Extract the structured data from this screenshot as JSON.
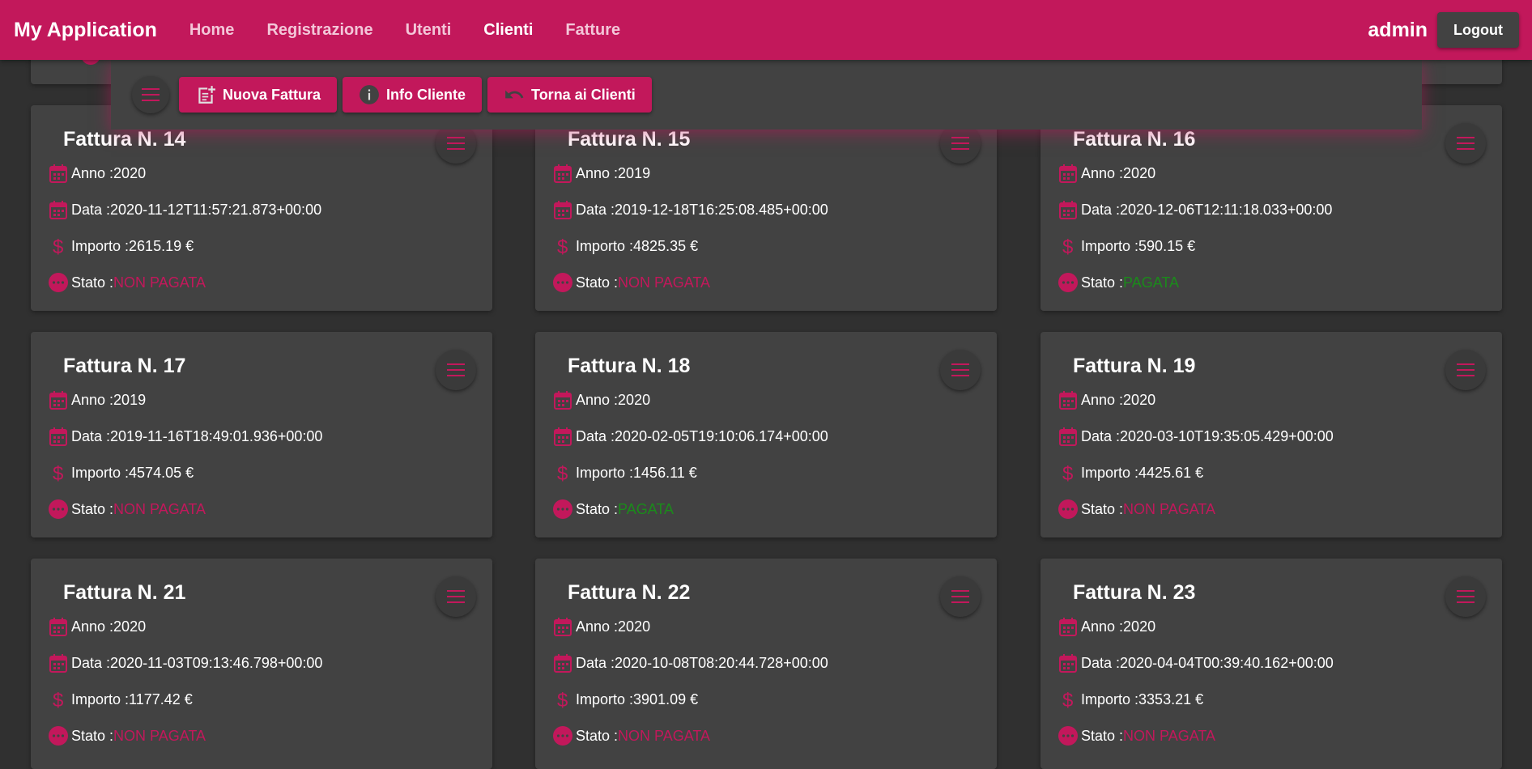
{
  "navbar": {
    "brand": "My Application",
    "links": [
      "Home",
      "Registrazione",
      "Utenti",
      "Clienti",
      "Fatture"
    ],
    "active_link": "Clienti",
    "user": "admin",
    "logout_label": "Logout"
  },
  "toolbar": {
    "buttons": [
      {
        "label": "Nuova Fattura",
        "icon": "new-invoice-icon"
      },
      {
        "label": "Info Cliente",
        "icon": "info-icon"
      },
      {
        "label": "Torna ai Clienti",
        "icon": "undo-icon"
      }
    ]
  },
  "labels": {
    "anno": "Anno : ",
    "data": "Data : ",
    "importo": "Importo : ",
    "stato": "Stato :",
    "currency": "€"
  },
  "colors": {
    "accent": "#c2185b",
    "background": "#303030",
    "card": "#424242",
    "paid": "#1b8a1b"
  },
  "invoices": [
    {
      "title": "Fattura N. 14",
      "anno": "2020",
      "data": "2020-11-12T11:57:21.873+00:00",
      "importo": "2615.19 €",
      "stato": "NON PAGATA"
    },
    {
      "title": "Fattura N. 15",
      "anno": "2019",
      "data": "2019-12-18T16:25:08.485+00:00",
      "importo": "4825.35 €",
      "stato": "NON PAGATA"
    },
    {
      "title": "Fattura N. 16",
      "anno": "2020",
      "data": "2020-12-06T12:11:18.033+00:00",
      "importo": "590.15 €",
      "stato": "PAGATA"
    },
    {
      "title": "Fattura N. 17",
      "anno": "2019",
      "data": "2019-11-16T18:49:01.936+00:00",
      "importo": "4574.05 €",
      "stato": "NON PAGATA"
    },
    {
      "title": "Fattura N. 18",
      "anno": "2020",
      "data": "2020-02-05T19:10:06.174+00:00",
      "importo": "1456.11 €",
      "stato": "PAGATA"
    },
    {
      "title": "Fattura N. 19",
      "anno": "2020",
      "data": "2020-03-10T19:35:05.429+00:00",
      "importo": "4425.61 €",
      "stato": "NON PAGATA"
    },
    {
      "title": "Fattura N. 21",
      "anno": "2020",
      "data": "2020-11-03T09:13:46.798+00:00",
      "importo": "1177.42 €",
      "stato": "NON PAGATA"
    },
    {
      "title": "Fattura N. 22",
      "anno": "2020",
      "data": "2020-10-08T08:20:44.728+00:00",
      "importo": "3901.09 €",
      "stato": "NON PAGATA"
    },
    {
      "title": "Fattura N. 23",
      "anno": "2020",
      "data": "2020-04-04T00:39:40.162+00:00",
      "importo": "3353.21 €",
      "stato": "NON PAGATA"
    }
  ]
}
